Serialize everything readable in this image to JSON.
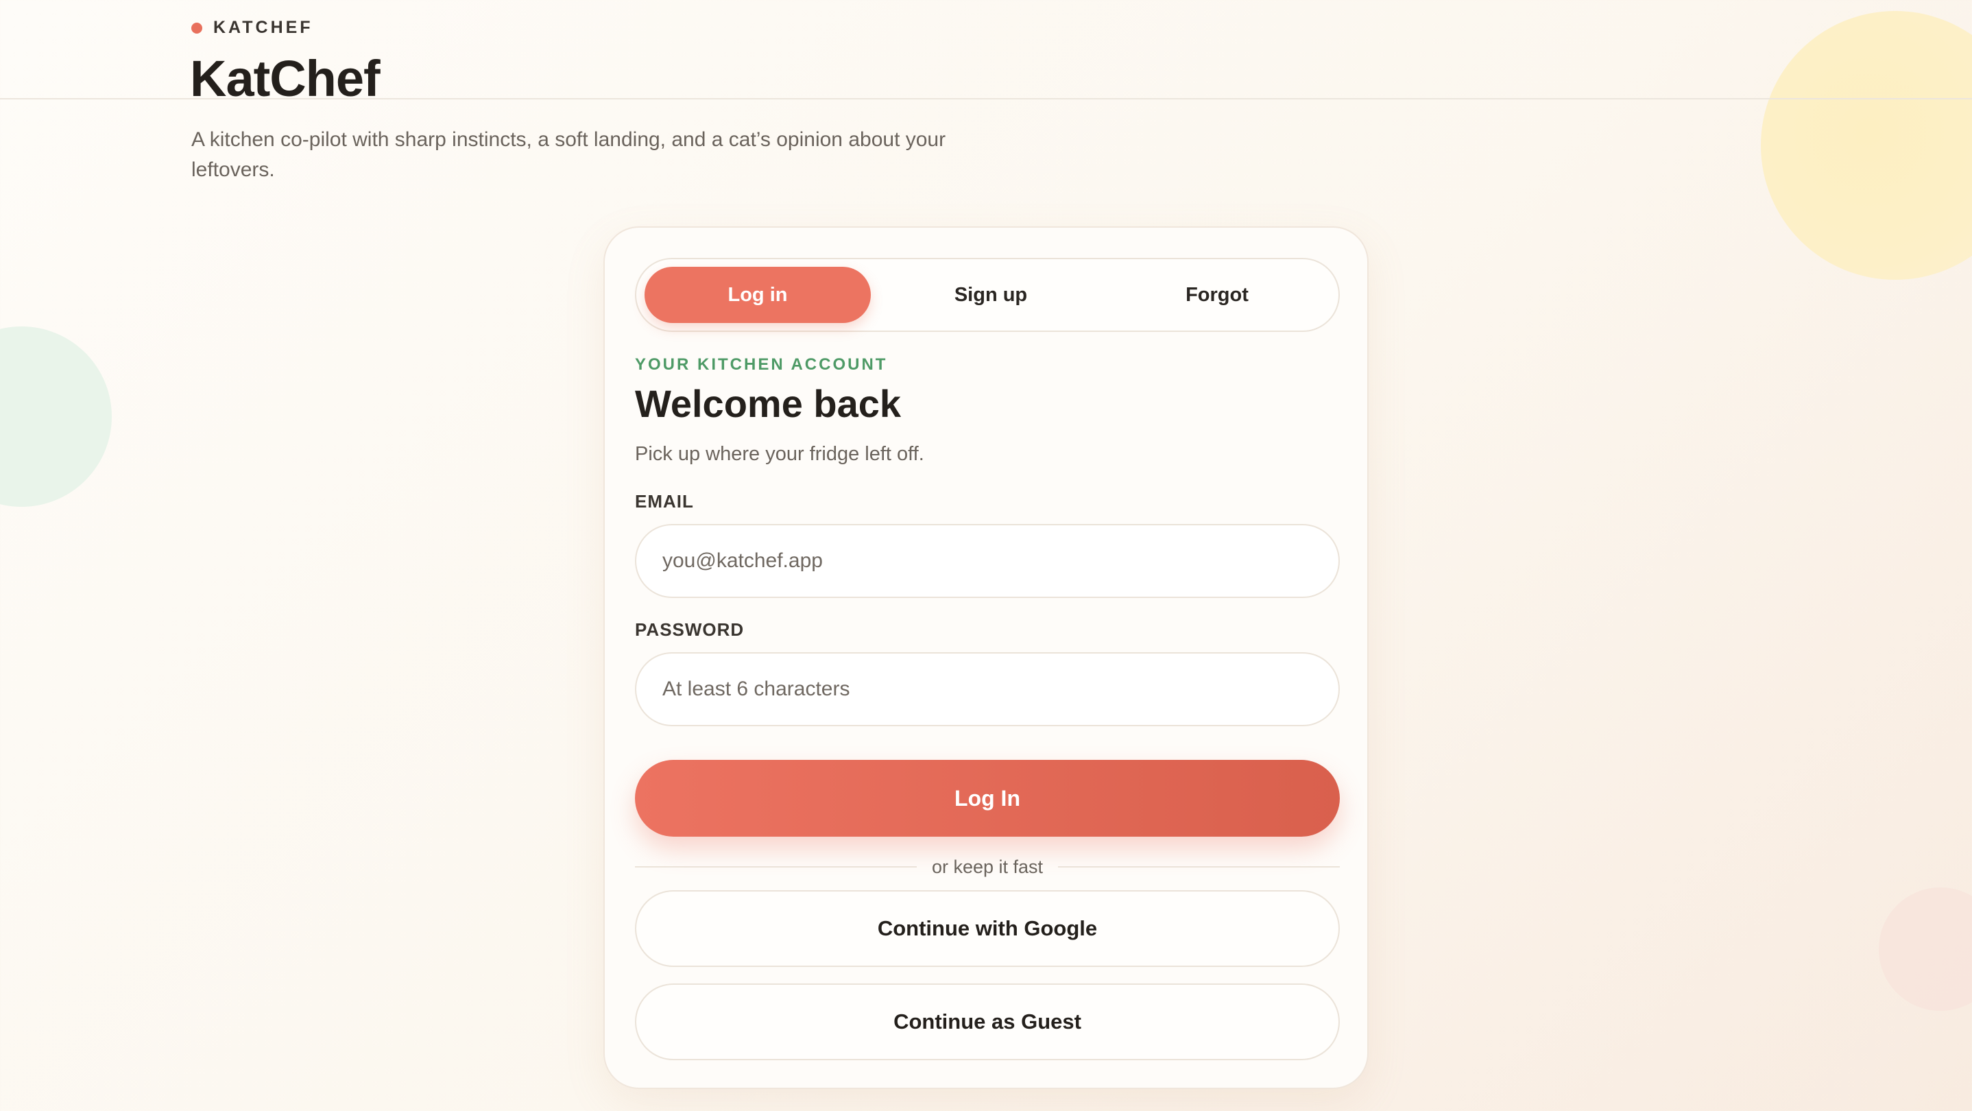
{
  "brand": {
    "label": "KATCHEF",
    "title": "KatChef",
    "tagline": "A kitchen co-pilot with sharp instincts, a soft landing, and a cat’s opinion about your leftovers."
  },
  "tabs": [
    {
      "label": "Log in",
      "active": true
    },
    {
      "label": "Sign up",
      "active": false
    },
    {
      "label": "Forgot",
      "active": false
    }
  ],
  "form": {
    "eyebrow": "YOUR KITCHEN ACCOUNT",
    "title": "Welcome back",
    "subtitle": "Pick up where your fridge left off.",
    "email_label": "EMAIL",
    "email_placeholder": "you@katchef.app",
    "email_value": "",
    "password_label": "PASSWORD",
    "password_placeholder": "At least 6 characters",
    "password_value": "",
    "submit_label": "Log In",
    "divider_text": "or keep it fast",
    "google_label": "Continue with Google",
    "guest_label": "Continue as Guest"
  },
  "colors": {
    "accent": "#ec7461",
    "accent_dark": "#d9604d",
    "eyebrow": "#4e9a66",
    "text": "#24201c",
    "muted": "#6a635c"
  }
}
